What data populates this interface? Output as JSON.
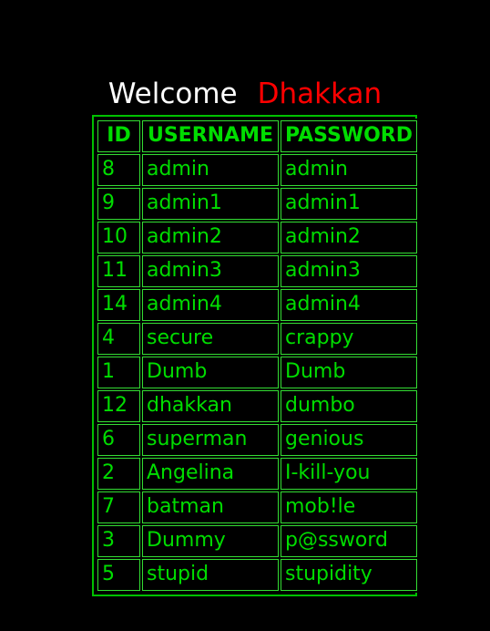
{
  "heading": {
    "welcome_text": "Welcome",
    "user_name": "Dhakkan"
  },
  "colors": {
    "background": "#000000",
    "table_border": "#00c000",
    "cell_border": "#33dd33",
    "text_green": "#00dd00",
    "welcome_white": "#ffffff",
    "user_red": "#ff0000"
  },
  "table": {
    "headers": {
      "id": "ID",
      "username": "USERNAME",
      "password": "PASSWORD"
    },
    "rows": [
      {
        "id": "8",
        "username": "admin",
        "password": "admin"
      },
      {
        "id": "9",
        "username": "admin1",
        "password": "admin1"
      },
      {
        "id": "10",
        "username": "admin2",
        "password": "admin2"
      },
      {
        "id": "11",
        "username": "admin3",
        "password": "admin3"
      },
      {
        "id": "14",
        "username": "admin4",
        "password": "admin4"
      },
      {
        "id": "4",
        "username": "secure",
        "password": "crappy"
      },
      {
        "id": "1",
        "username": "Dumb",
        "password": "Dumb"
      },
      {
        "id": "12",
        "username": "dhakkan",
        "password": "dumbo"
      },
      {
        "id": "6",
        "username": "superman",
        "password": "genious"
      },
      {
        "id": "2",
        "username": "Angelina",
        "password": "I-kill-you"
      },
      {
        "id": "7",
        "username": "batman",
        "password": "mob!le"
      },
      {
        "id": "3",
        "username": "Dummy",
        "password": "p@ssword"
      },
      {
        "id": "5",
        "username": "stupid",
        "password": "stupidity"
      }
    ]
  }
}
